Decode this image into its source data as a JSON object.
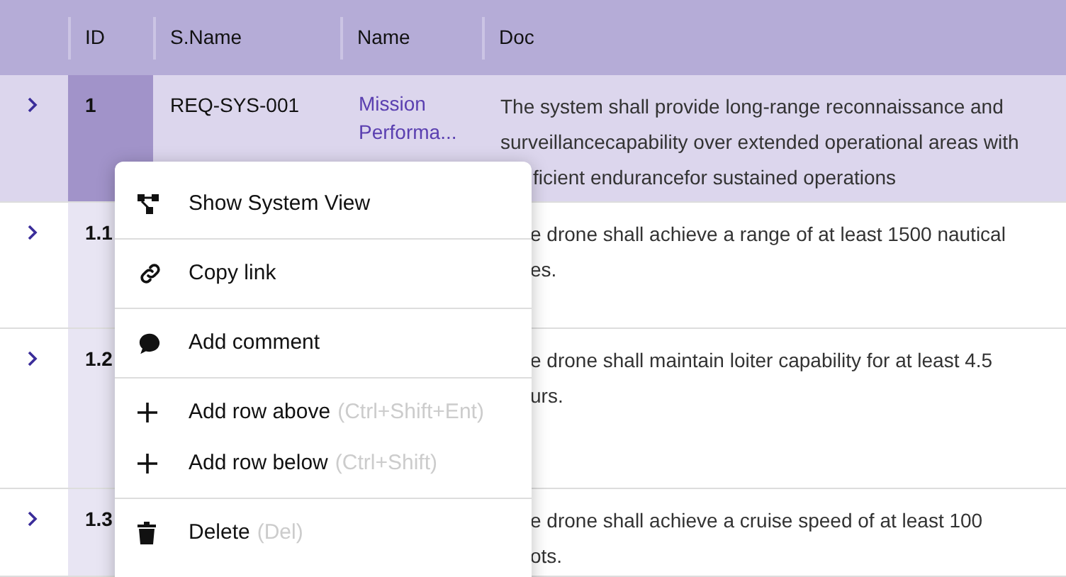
{
  "table": {
    "columns": [
      "ID",
      "S.Name",
      "Name",
      "Doc"
    ],
    "rows": [
      {
        "id": "1",
        "s_name": "REQ-SYS-001",
        "name": [
          "Mission",
          "Performa..."
        ],
        "doc": [
          "The system shall provide long-range reconnaissance and",
          "surveillancecapability over extended operational areas with",
          "ficient endurancefor sustained operations"
        ],
        "selected": true
      },
      {
        "id": "1.1",
        "doc": [
          "e drone shall achieve a range of at least 1500 nautical",
          "es."
        ],
        "selected": false
      },
      {
        "id": "1.2",
        "doc": [
          "e drone shall maintain loiter capability for at least 4.5",
          "urs."
        ],
        "selected": false
      },
      {
        "id": "1.3",
        "doc": [
          "e drone shall achieve a cruise speed of at least 100",
          "ots."
        ],
        "selected": false
      }
    ]
  },
  "context_menu": {
    "groups": [
      [
        {
          "kind": "system-view",
          "label": "Show System View"
        }
      ],
      [
        {
          "kind": "link",
          "label": "Copy link"
        }
      ],
      [
        {
          "kind": "comment",
          "label": "Add comment"
        }
      ],
      [
        {
          "kind": "add",
          "label": "Add row above",
          "shortcut": "(Ctrl+Shift+Ent)"
        },
        {
          "kind": "add",
          "label": "Add row below",
          "shortcut": "(Ctrl+Shift)"
        }
      ],
      [
        {
          "kind": "delete",
          "label": "Delete",
          "shortcut": "(Del)"
        }
      ]
    ]
  }
}
